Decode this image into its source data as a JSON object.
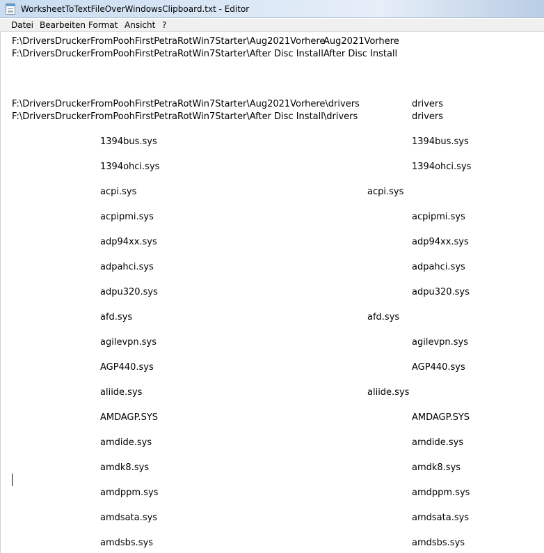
{
  "window": {
    "title": "WorksheetToTextFileOverWindowsClipboard.txt - Editor"
  },
  "menu": [
    "Datei",
    "Bearbeiten",
    "Format",
    "Ansicht",
    "?"
  ],
  "content": {
    "header_rows": [
      {
        "path": "F:\\DriversDruckerFromPoohFirstPetraRotWin7Starter\\Aug2021Vorhere",
        "name": "Aug2021Vorhere"
      },
      {
        "path": "F:\\DriversDruckerFromPoohFirstPetraRotWin7Starter\\After Disc Install",
        "name": "After Disc Install"
      },
      {
        "path": "F:\\DriversDruckerFromPoohFirstPetraRotWin7Starter\\Aug2021Vorhere\\drivers",
        "name": "drivers"
      },
      {
        "path": "F:\\DriversDruckerFromPoohFirstPetraRotWin7Starter\\After Disc Install\\drivers",
        "name": "drivers"
      }
    ],
    "files": [
      {
        "name": "1394bus.sys",
        "match": "1394bus.sys",
        "column": "right"
      },
      {
        "name": "1394ohci.sys",
        "match": "1394ohci.sys",
        "column": "right"
      },
      {
        "name": "acpi.sys",
        "match": "acpi.sys",
        "column": "middle"
      },
      {
        "name": "acpipmi.sys",
        "match": "acpipmi.sys",
        "column": "right"
      },
      {
        "name": "adp94xx.sys",
        "match": "adp94xx.sys",
        "column": "right"
      },
      {
        "name": "adpahci.sys",
        "match": "adpahci.sys",
        "column": "right"
      },
      {
        "name": "adpu320.sys",
        "match": "adpu320.sys",
        "column": "right"
      },
      {
        "name": "afd.sys",
        "match": "afd.sys",
        "column": "middle"
      },
      {
        "name": "agilevpn.sys",
        "match": "agilevpn.sys",
        "column": "right"
      },
      {
        "name": "AGP440.sys",
        "match": "AGP440.sys",
        "column": "right"
      },
      {
        "name": "aliide.sys",
        "match": "aliide.sys",
        "column": "middle"
      },
      {
        "name": "AMDAGP.SYS",
        "match": "AMDAGP.SYS",
        "column": "right"
      },
      {
        "name": "amdide.sys",
        "match": "amdide.sys",
        "column": "right"
      },
      {
        "name": "amdk8.sys",
        "match": "amdk8.sys",
        "column": "right"
      },
      {
        "name": "amdppm.sys",
        "match": "amdppm.sys",
        "column": "right"
      },
      {
        "name": "amdsata.sys",
        "match": "amdsata.sys",
        "column": "right"
      },
      {
        "name": "amdsbs.sys",
        "match": "amdsbs.sys",
        "column": "right"
      }
    ]
  }
}
